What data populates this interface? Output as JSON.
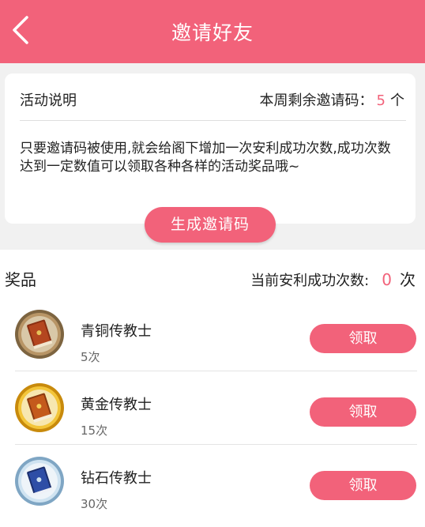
{
  "header": {
    "title": "邀请好友"
  },
  "activity": {
    "title": "活动说明",
    "remaining_label": "本周剩余邀请码：",
    "remaining_value": "5",
    "remaining_unit": "个",
    "description": "只要邀请码被使用,就会给阁下增加一次安利成功次数,成功次数达到一定数值可以领取各种各样的活动奖品哦~"
  },
  "generate_button": "生成邀请码",
  "prizes": {
    "label": "奖品",
    "count_label": "当前安利成功次数:",
    "count_value": "0",
    "count_unit": "次",
    "items": [
      {
        "name": "青铜传教士",
        "count": "5次",
        "button": "领取",
        "tier_color": "#9a7a4e"
      },
      {
        "name": "黄金传教士",
        "count": "15次",
        "button": "领取",
        "tier_color": "#e8b21c"
      },
      {
        "name": "钻石传教士",
        "count": "30次",
        "button": "领取",
        "tier_color": "#9cc6e4"
      }
    ]
  },
  "colors": {
    "accent": "#f2627a",
    "background_grey": "#f1f1f1"
  }
}
